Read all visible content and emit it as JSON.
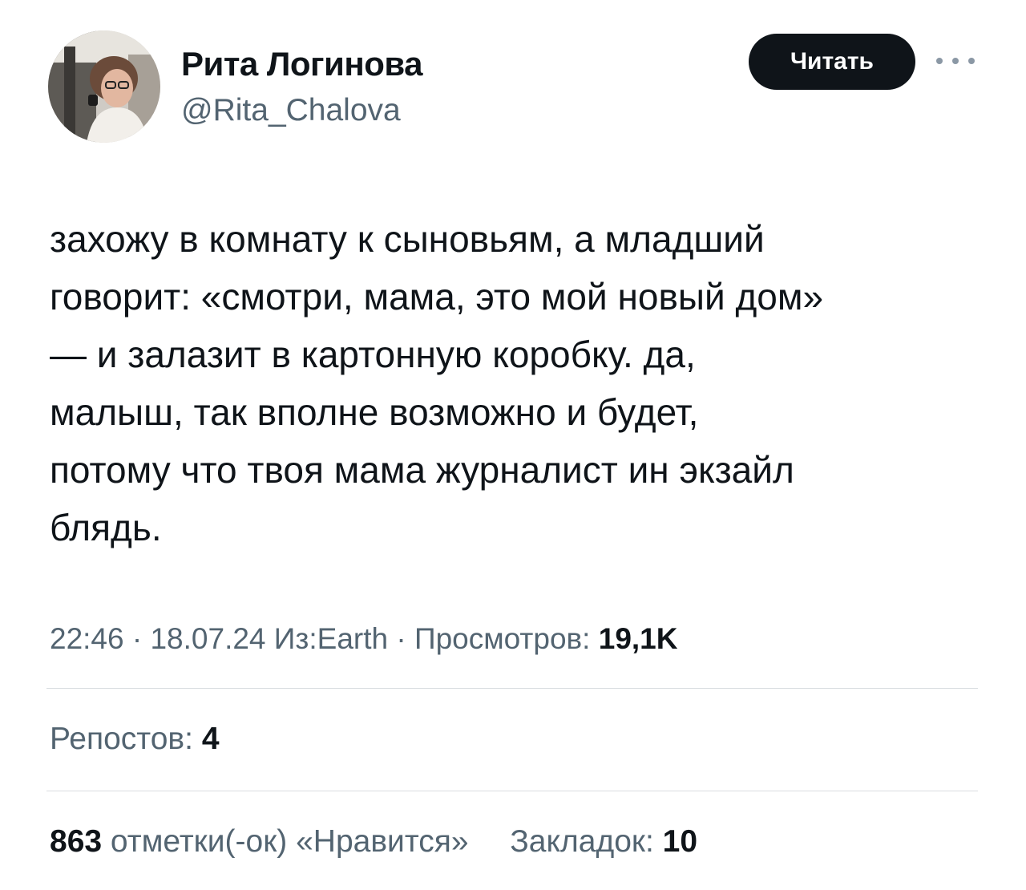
{
  "author": {
    "display_name": "Рита Логинова",
    "handle": "@Rita_Chalova",
    "avatar_icon": "profile-photo"
  },
  "follow_button": {
    "label": "Читать"
  },
  "more_icon": "ellipsis-icon",
  "tweet": {
    "lines": [
      "захожу в комнату к сыновьям, а младший",
      "говорит: «смотри, мама, это мой новый дом»",
      "— и залазит в картонную коробку. да,",
      "малыш, так вполне возможно и будет,",
      "потому что твоя мама журналист ин экзайл",
      "блядь."
    ]
  },
  "meta": {
    "time": "22:46",
    "dot1": "·",
    "date": "18.07.24",
    "source": "Из:Earth",
    "dot2": "·",
    "views_label": "Просмотров:",
    "views_value": "19,1K"
  },
  "stats": {
    "reposts_label": "Репостов:",
    "reposts_value": "4",
    "likes_value": "863",
    "likes_label": "отметки(-ок) «Нравится»",
    "bookmarks_label": "Закладок:",
    "bookmarks_value": "10"
  },
  "colors": {
    "text_primary": "#0f1419",
    "text_secondary": "#536471",
    "button_bg": "#0f1419",
    "divider": "#d9dde0"
  }
}
